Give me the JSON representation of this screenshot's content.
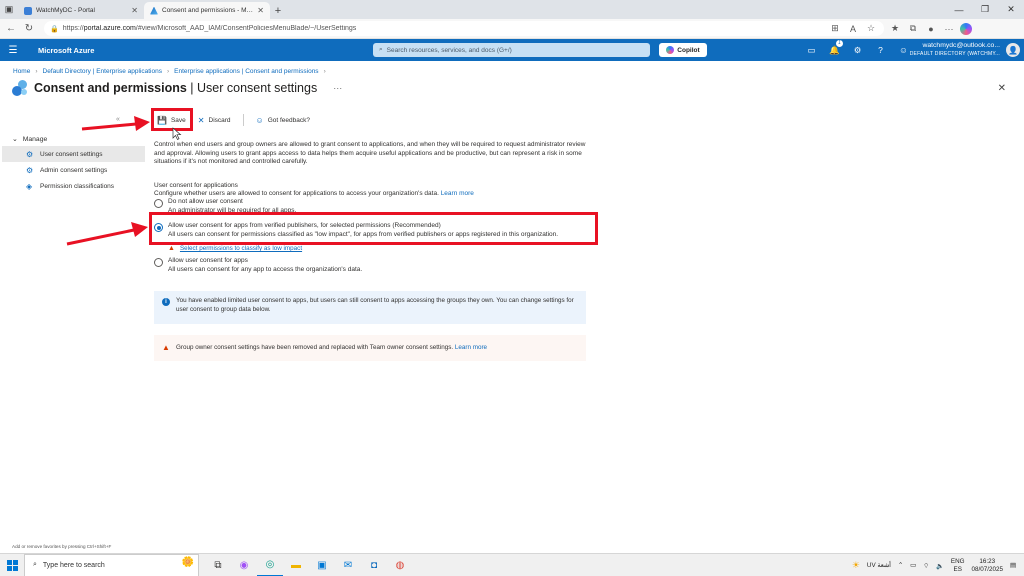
{
  "browser": {
    "tabs": [
      {
        "title": "WatchMyDC - Portal",
        "active": false
      },
      {
        "title": "Consent and permissions - Micro",
        "active": true
      }
    ],
    "url_prefix": "https://",
    "url_host": "portal.azure.com",
    "url_path": "/#view/Microsoft_AAD_IAM/ConsentPoliciesMenuBlade/~/UserSettings"
  },
  "azure": {
    "brand": "Microsoft Azure",
    "search_placeholder": "Search resources, services, and docs (G+/)",
    "copilot_label": "Copilot",
    "notification_count": "1",
    "account_email": "watchmydc@outlook.co...",
    "account_directory": "DEFAULT DIRECTORY (WATCHMY..."
  },
  "breadcrumb": [
    "Home",
    "Default Directory | Enterprise applications",
    "Enterprise applications | Consent and permissions"
  ],
  "page": {
    "title_bold": "Consent and permissions",
    "title_rest": "| User consent settings",
    "more": "···",
    "close": "✕"
  },
  "sidebar": {
    "collapse": "«",
    "section": "Manage",
    "items": [
      {
        "label": "User consent settings",
        "selected": true
      },
      {
        "label": "Admin consent settings",
        "selected": false
      },
      {
        "label": "Permission classifications",
        "selected": false
      }
    ]
  },
  "toolbar": {
    "save_label": "Save",
    "discard_label": "Discard",
    "feedback_label": "Got feedback?"
  },
  "content": {
    "description": "Control when end users and group owners are allowed to grant consent to applications, and when they will be required to request administrator review and approval. Allowing users to grant apps access to data helps them acquire useful applications and be productive, but can represent a risk in some situations if it's not monitored and controlled carefully.",
    "section_title": "User consent for applications",
    "section_sub": "Configure whether users are allowed to consent for applications to access your organization's data.",
    "learn_more": "Learn more",
    "options": [
      {
        "title": "Do not allow user consent",
        "desc": "An administrator will be required for all apps.",
        "selected": false
      },
      {
        "title": "Allow user consent for apps from verified publishers, for selected permissions (Recommended)",
        "desc": "All users can consent for permissions classified as \"low impact\", for apps from verified publishers or apps registered in this organization.",
        "selected": true
      },
      {
        "title": "Allow user consent for apps",
        "desc": "All users can consent for any app to access the organization's data.",
        "selected": false
      }
    ],
    "low_impact_link": "Select permissions to classify as low impact",
    "info_message": "You have enabled limited user consent to apps, but users can still consent to apps accessing the groups they own. You can change settings for user consent to group data below.",
    "warning_message": "Group owner consent settings have been removed and replaced with Team owner consent settings.",
    "warning_link": "Learn more"
  },
  "footer_hint": "Add or remove favorites by pressing Ctrl+Shift+F",
  "taskbar": {
    "search_placeholder": "Type here to search",
    "weather": "UV أشعة",
    "lang_top": "ENG",
    "lang_bottom": "ES",
    "time": "16:23",
    "date": "08/07/2025"
  },
  "colors": {
    "azure_blue": "#0f6cbd",
    "highlight_red": "#e81123"
  }
}
